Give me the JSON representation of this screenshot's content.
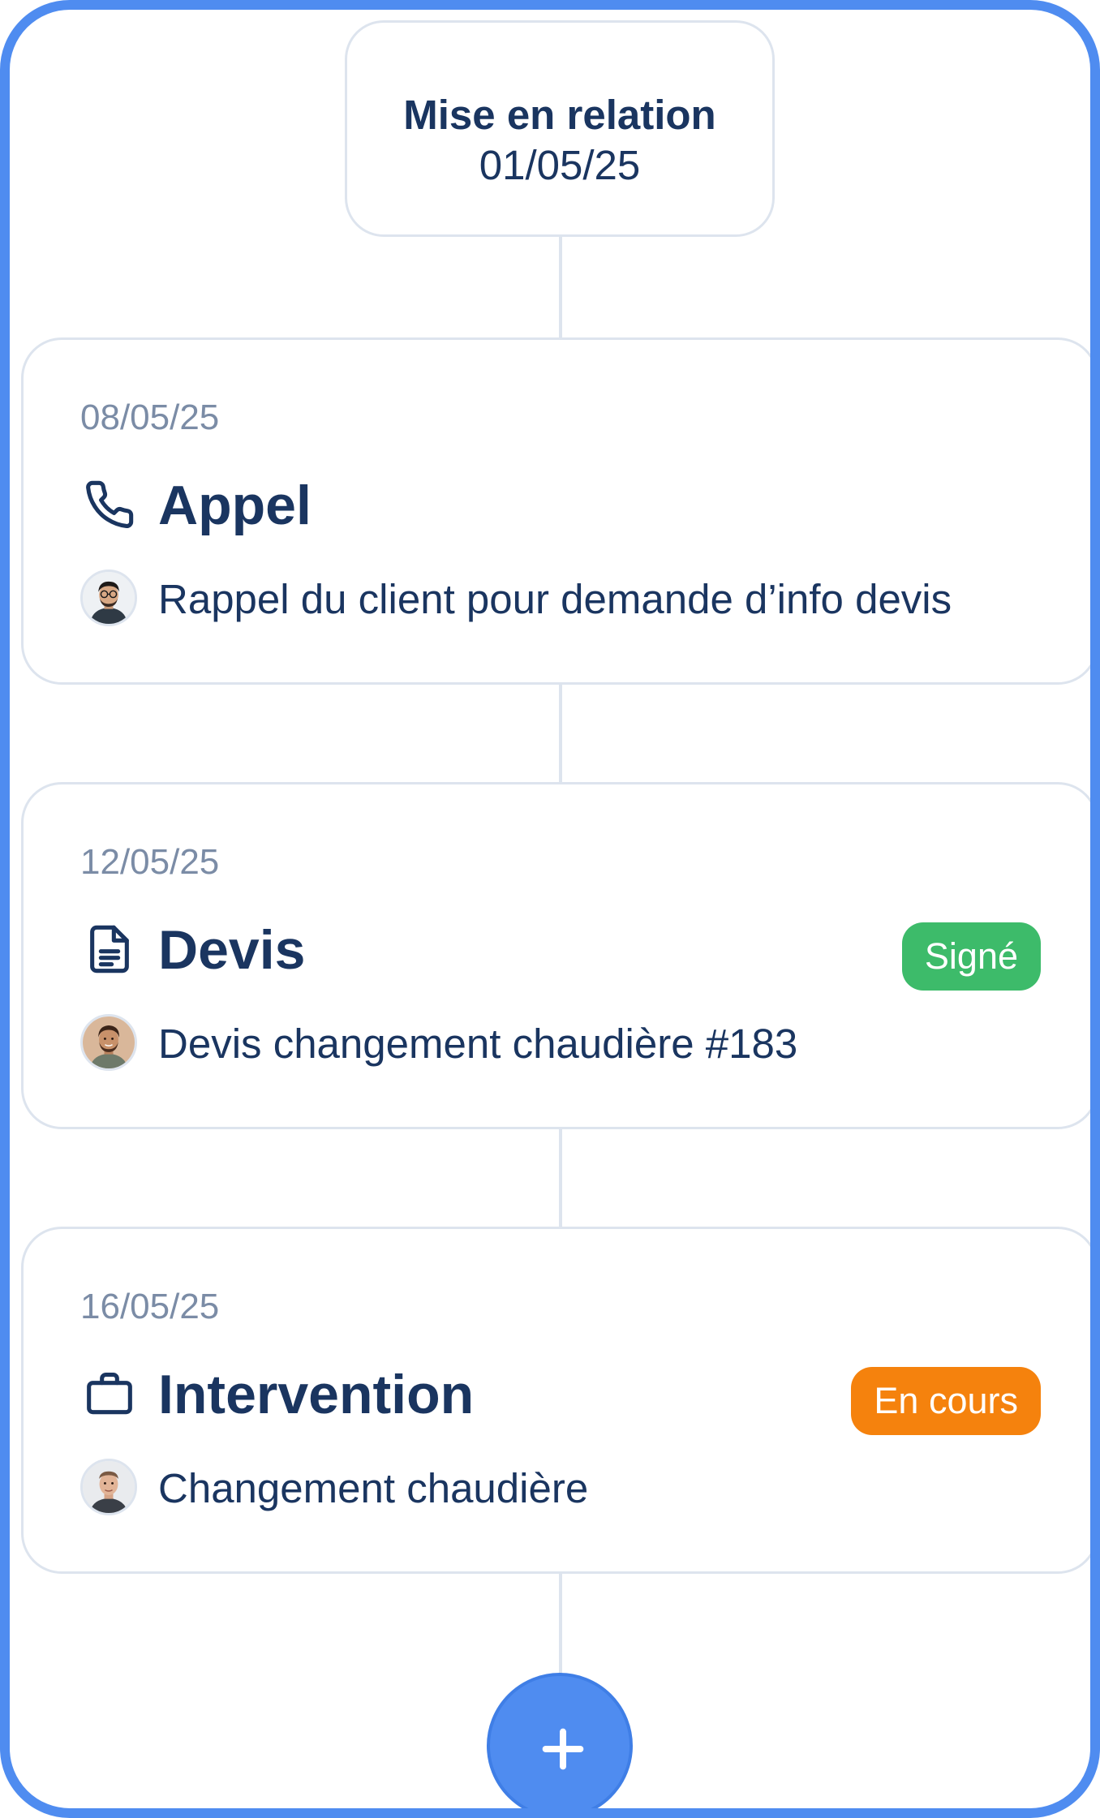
{
  "origin": {
    "title": "Mise en relation",
    "date": "01/05/25"
  },
  "events": [
    {
      "date": "08/05/25",
      "icon": "phone-icon",
      "title": "Appel",
      "avatar": "avatar-man-glasses",
      "description": "Rappel du client pour demande d’info devis",
      "badge": null
    },
    {
      "date": "12/05/25",
      "icon": "document-icon",
      "title": "Devis",
      "avatar": "avatar-man-beard",
      "description": "Devis changement chaudière #183",
      "badge": {
        "label": "Signé",
        "color": "#3dbb6a"
      }
    },
    {
      "date": "16/05/25",
      "icon": "briefcase-icon",
      "title": "Intervention",
      "avatar": "avatar-man-bald",
      "description": "Changement chaudière",
      "badge": {
        "label": "En cours",
        "color": "#f5820d"
      }
    }
  ],
  "add_button": {
    "icon": "plus-icon"
  },
  "colors": {
    "accent": "#4f8cf0",
    "text_primary": "#1a3560",
    "text_muted": "#7b8ca6",
    "border": "#dde4ee",
    "badge_signed": "#3dbb6a",
    "badge_in_progress": "#f5820d"
  }
}
